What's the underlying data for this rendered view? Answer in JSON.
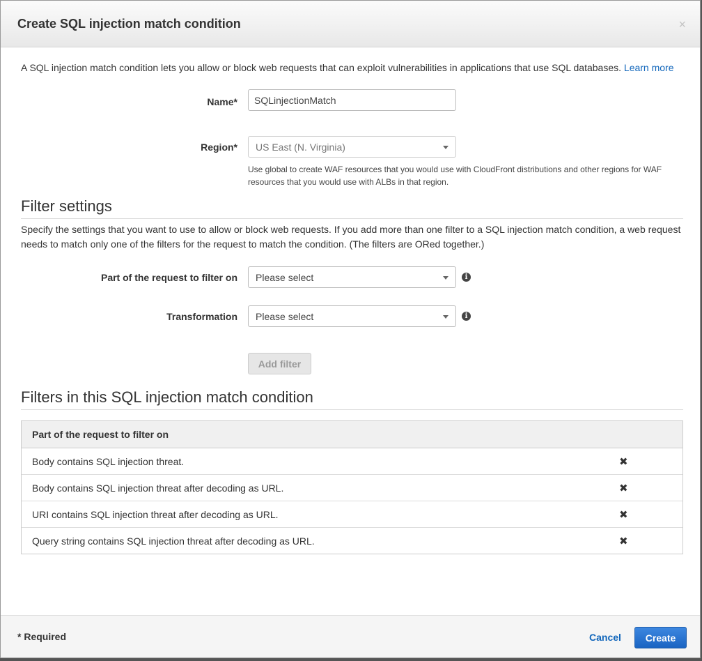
{
  "dialog": {
    "title": "Create SQL injection match condition",
    "close_symbol": "×"
  },
  "intro": {
    "text": "A SQL injection match condition lets you allow or block web requests that can exploit vulnerabilities in applications that use SQL databases.",
    "learn_more": "Learn more"
  },
  "form": {
    "name_label": "Name*",
    "name_value": "SQLinjectionMatch",
    "region_label": "Region*",
    "region_value": "US East (N. Virginia)",
    "region_help": "Use global to create WAF resources that you would use with CloudFront distributions and other regions for WAF resources that you would use with ALBs in that region."
  },
  "filter_settings": {
    "title": "Filter settings",
    "description": "Specify the settings that you want to use to allow or block web requests. If you add more than one filter to a SQL injection match condition, a web request needs to match only one of the filters for the request to match the condition. (The filters are ORed together.)",
    "part_label": "Part of the request to filter on",
    "part_value": "Please select",
    "transformation_label": "Transformation",
    "transformation_value": "Please select",
    "info_symbol": "i",
    "add_filter": "Add filter"
  },
  "filters_table": {
    "title": "Filters in this SQL injection match condition",
    "header": "Part of the request to filter on",
    "remove_symbol": "✖",
    "rows": [
      "Body contains SQL injection threat.",
      "Body contains SQL injection threat after decoding as URL.",
      "URI contains SQL injection threat after decoding as URL.",
      "Query string contains SQL injection threat after decoding as URL."
    ]
  },
  "footer": {
    "required_note": "* Required",
    "cancel": "Cancel",
    "create": "Create"
  },
  "colors": {
    "link": "#1166bb",
    "primary_button": "#2a74d4"
  }
}
